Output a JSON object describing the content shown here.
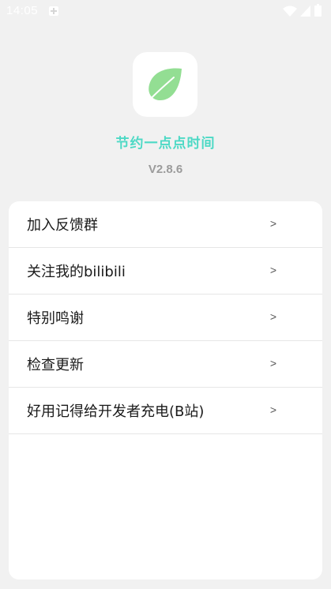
{
  "status_bar": {
    "time": "14:05",
    "icons": [
      "notification-icon",
      "wifi-icon",
      "signal-icon",
      "battery-icon"
    ]
  },
  "app": {
    "icon": "leaf-icon",
    "name": "节约一点点时间",
    "version": "V2.8.6",
    "accent_color": "#4dd9c5"
  },
  "menu": {
    "items": [
      {
        "label": "加入反馈群",
        "arrow": ">"
      },
      {
        "label": "关注我的bilibili",
        "arrow": ">"
      },
      {
        "label": "特别鸣谢",
        "arrow": ">"
      },
      {
        "label": "检查更新",
        "arrow": ">"
      },
      {
        "label": "好用记得给开发者充电(B站)",
        "arrow": ">"
      }
    ]
  }
}
